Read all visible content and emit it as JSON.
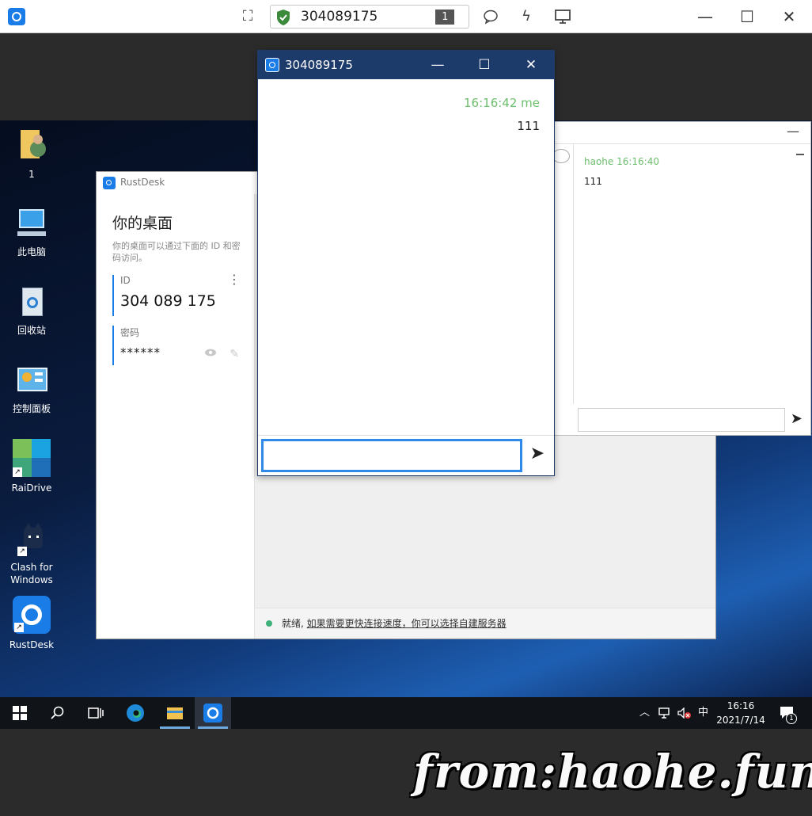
{
  "toolbar": {
    "remote_id": "304089175",
    "monitor_number": "1"
  },
  "desktop": {
    "icons": [
      {
        "label": "1"
      },
      {
        "label": "此电脑"
      },
      {
        "label": "回收站"
      },
      {
        "label": "控制面板"
      },
      {
        "label": "RaiDrive"
      },
      {
        "label": "Clash for Windows"
      },
      {
        "label": "RustDesk"
      }
    ]
  },
  "rustdesk": {
    "window_title": "RustDesk",
    "heading": "你的桌面",
    "description": "你的桌面可以通过下面的 ID 和密码访问。",
    "id_label": "ID",
    "id_value": "304 089 175",
    "password_label": "密码",
    "password_value": "******",
    "status_prefix": "就绪, ",
    "status_link": "如果需要更快连接速度，你可以选择自建服务器"
  },
  "chat_host": {
    "message_meta": "haohe 16:16:40",
    "message_text": "111"
  },
  "chat_fg": {
    "title": "304089175",
    "message_meta": "16:16:42  me",
    "message_text": "111",
    "input_value": ""
  },
  "taskbar": {
    "ime": "中",
    "time": "16:16",
    "date": "2021/7/14",
    "notification_count": "1"
  },
  "watermark": "from:haohe.fun",
  "colors": {
    "accent": "#1a7ce6",
    "chat_titlebar": "#1c3a6a",
    "meta_green": "#6cbf6c",
    "status_green": "#3fb17a"
  }
}
